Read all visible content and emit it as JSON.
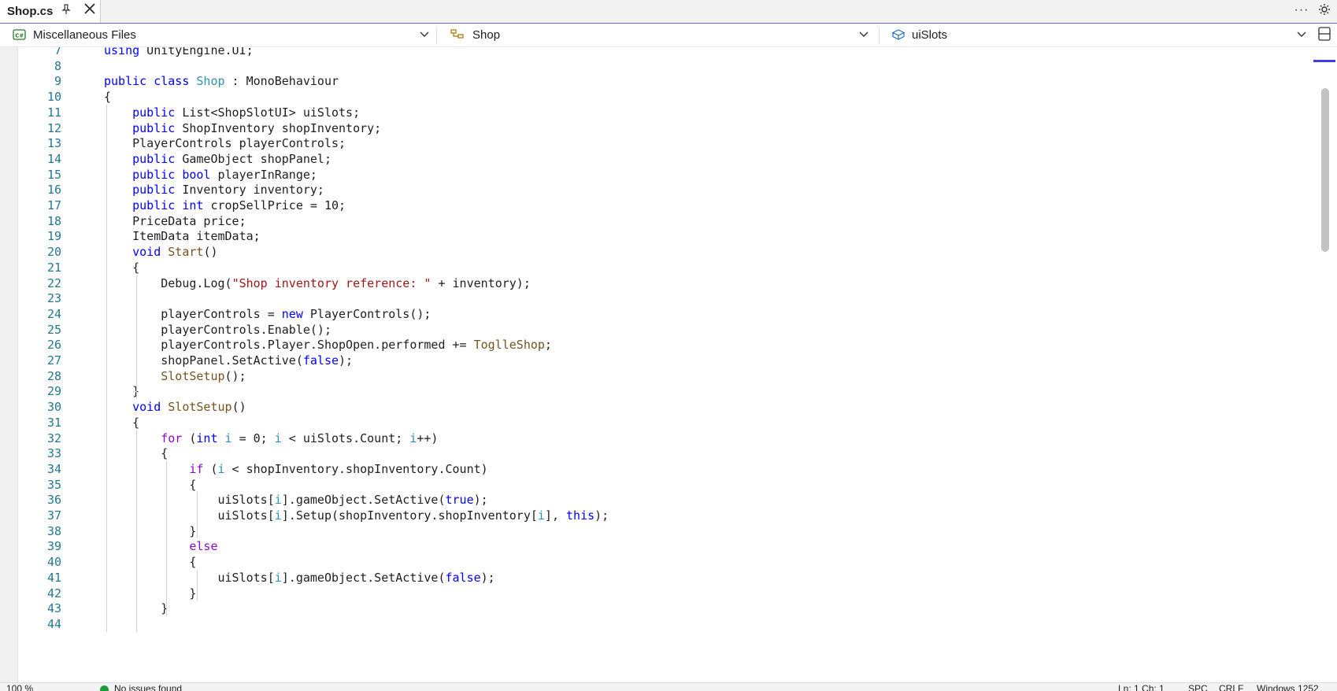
{
  "tab": {
    "title": "Shop.cs",
    "pin_icon": "pin-icon",
    "close_icon": "close-icon"
  },
  "navbar": {
    "project": "Miscellaneous Files",
    "type": "Shop",
    "member": "uiSlots"
  },
  "colors": {
    "accent": "#6b69d6",
    "keyword": "#0000ff",
    "type": "#2b91af",
    "string": "#a31515",
    "method": "#74531f",
    "control": "#8f08c4",
    "line_number": "#237893"
  },
  "code": [
    {
      "n": "7",
      "t": [
        [
          "kw",
          "using"
        ],
        [
          "p",
          " UnityEngine.UI;"
        ]
      ]
    },
    {
      "n": "8",
      "t": []
    },
    {
      "n": "9",
      "t": [
        [
          "kw",
          "public"
        ],
        [
          "p",
          " "
        ],
        [
          "kw",
          "class"
        ],
        [
          "p",
          " "
        ],
        [
          "ty",
          "Shop"
        ],
        [
          "p",
          " : MonoBehaviour"
        ]
      ]
    },
    {
      "n": "10",
      "t": [
        [
          "p",
          "{"
        ]
      ]
    },
    {
      "n": "11",
      "t": [
        [
          "p",
          "    "
        ],
        [
          "kw",
          "public"
        ],
        [
          "p",
          " List<ShopSlotUI> uiSlots;"
        ]
      ]
    },
    {
      "n": "12",
      "t": [
        [
          "p",
          "    "
        ],
        [
          "kw",
          "public"
        ],
        [
          "p",
          " ShopInventory shopInventory;"
        ]
      ]
    },
    {
      "n": "13",
      "t": [
        [
          "p",
          "    PlayerControls playerControls;"
        ]
      ]
    },
    {
      "n": "14",
      "t": [
        [
          "p",
          "    "
        ],
        [
          "kw",
          "public"
        ],
        [
          "p",
          " GameObject shopPanel;"
        ]
      ]
    },
    {
      "n": "15",
      "t": [
        [
          "p",
          "    "
        ],
        [
          "kw",
          "public"
        ],
        [
          "p",
          " "
        ],
        [
          "kw",
          "bool"
        ],
        [
          "p",
          " playerInRange;"
        ]
      ]
    },
    {
      "n": "16",
      "t": [
        [
          "p",
          "    "
        ],
        [
          "kw",
          "public"
        ],
        [
          "p",
          " Inventory inventory;"
        ]
      ]
    },
    {
      "n": "17",
      "t": [
        [
          "p",
          "    "
        ],
        [
          "kw",
          "public"
        ],
        [
          "p",
          " "
        ],
        [
          "kw",
          "int"
        ],
        [
          "p",
          " cropSellPrice = 10;"
        ]
      ]
    },
    {
      "n": "18",
      "t": [
        [
          "p",
          "    PriceData price;"
        ]
      ]
    },
    {
      "n": "19",
      "t": [
        [
          "p",
          "    ItemData itemData;"
        ]
      ]
    },
    {
      "n": "20",
      "t": [
        [
          "p",
          "    "
        ],
        [
          "kw",
          "void"
        ],
        [
          "p",
          " "
        ],
        [
          "mth",
          "Start"
        ],
        [
          "p",
          "()"
        ]
      ]
    },
    {
      "n": "21",
      "t": [
        [
          "p",
          "    {"
        ]
      ]
    },
    {
      "n": "22",
      "t": [
        [
          "p",
          "        Debug.Log("
        ],
        [
          "str",
          "\"Shop inventory reference: \""
        ],
        [
          "p",
          " + inventory);"
        ]
      ]
    },
    {
      "n": "23",
      "t": []
    },
    {
      "n": "24",
      "t": [
        [
          "p",
          "        playerControls = "
        ],
        [
          "kw",
          "new"
        ],
        [
          "p",
          " PlayerControls();"
        ]
      ]
    },
    {
      "n": "25",
      "t": [
        [
          "p",
          "        playerControls.Enable();"
        ]
      ]
    },
    {
      "n": "26",
      "t": [
        [
          "p",
          "        playerControls.Player.ShopOpen.performed += "
        ],
        [
          "mth",
          "ToglleShop"
        ],
        [
          "p",
          ";"
        ]
      ]
    },
    {
      "n": "27",
      "t": [
        [
          "p",
          "        shopPanel.SetActive("
        ],
        [
          "kw",
          "false"
        ],
        [
          "p",
          ");"
        ]
      ]
    },
    {
      "n": "28",
      "t": [
        [
          "p",
          "        "
        ],
        [
          "mth",
          "SlotSetup"
        ],
        [
          "p",
          "();"
        ]
      ]
    },
    {
      "n": "29",
      "t": [
        [
          "p",
          "    }"
        ]
      ]
    },
    {
      "n": "30",
      "t": [
        [
          "p",
          "    "
        ],
        [
          "kw",
          "void"
        ],
        [
          "p",
          " "
        ],
        [
          "mth",
          "SlotSetup"
        ],
        [
          "p",
          "()"
        ]
      ]
    },
    {
      "n": "31",
      "t": [
        [
          "p",
          "    {"
        ]
      ]
    },
    {
      "n": "32",
      "t": [
        [
          "p",
          "        "
        ],
        [
          "ctl",
          "for"
        ],
        [
          "p",
          " ("
        ],
        [
          "kw",
          "int"
        ],
        [
          "p",
          " "
        ],
        [
          "ty",
          "i"
        ],
        [
          "p",
          " = 0; "
        ],
        [
          "ty",
          "i"
        ],
        [
          "p",
          " < uiSlots.Count; "
        ],
        [
          "ty",
          "i"
        ],
        [
          "p",
          "++)"
        ]
      ]
    },
    {
      "n": "33",
      "t": [
        [
          "p",
          "        {"
        ]
      ]
    },
    {
      "n": "34",
      "t": [
        [
          "p",
          "            "
        ],
        [
          "ctl",
          "if"
        ],
        [
          "p",
          " ("
        ],
        [
          "ty",
          "i"
        ],
        [
          "p",
          " < shopInventory.shopInventory.Count)"
        ]
      ]
    },
    {
      "n": "35",
      "t": [
        [
          "p",
          "            {"
        ]
      ]
    },
    {
      "n": "36",
      "t": [
        [
          "p",
          "                uiSlots["
        ],
        [
          "ty",
          "i"
        ],
        [
          "p",
          "].gameObject.SetActive("
        ],
        [
          "kw",
          "true"
        ],
        [
          "p",
          ");"
        ]
      ]
    },
    {
      "n": "37",
      "t": [
        [
          "p",
          "                uiSlots["
        ],
        [
          "ty",
          "i"
        ],
        [
          "p",
          "].Setup(shopInventory.shopInventory["
        ],
        [
          "ty",
          "i"
        ],
        [
          "p",
          "], "
        ],
        [
          "kw",
          "this"
        ],
        [
          "p",
          ");"
        ]
      ]
    },
    {
      "n": "38",
      "t": [
        [
          "p",
          "            }"
        ]
      ]
    },
    {
      "n": "39",
      "t": [
        [
          "p",
          "            "
        ],
        [
          "ctl",
          "else"
        ]
      ]
    },
    {
      "n": "40",
      "t": [
        [
          "p",
          "            {"
        ]
      ]
    },
    {
      "n": "41",
      "t": [
        [
          "p",
          "                uiSlots["
        ],
        [
          "ty",
          "i"
        ],
        [
          "p",
          "].gameObject.SetActive("
        ],
        [
          "kw",
          "false"
        ],
        [
          "p",
          ");"
        ]
      ]
    },
    {
      "n": "42",
      "t": [
        [
          "p",
          "            }"
        ]
      ]
    },
    {
      "n": "43",
      "t": [
        [
          "p",
          "        }"
        ]
      ]
    },
    {
      "n": "44",
      "t": []
    }
  ],
  "status": {
    "zoom": "100 %",
    "issues": "No issues found",
    "position": "Ln: 1  Ch: 1",
    "whitespace": "SPC",
    "line_ending": "CRLF",
    "encoding": "Windows 1252"
  }
}
